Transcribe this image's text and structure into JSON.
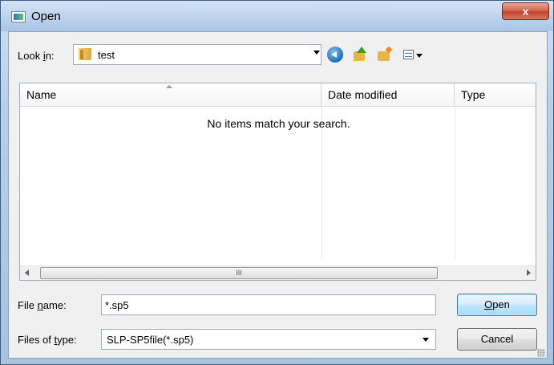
{
  "window": {
    "title": "Open",
    "close_symbol": "x",
    "icon": "app-icon"
  },
  "look_in": {
    "label_prefix": "Look ",
    "label_accel": "i",
    "label_suffix": "n:",
    "value": "test",
    "folder_icon": "folder-icon"
  },
  "toolbar": {
    "icons": [
      "back-icon",
      "up-folder-icon",
      "new-folder-icon",
      "views-icon"
    ]
  },
  "filelist": {
    "columns": [
      "Name",
      "Date modified",
      "Type"
    ],
    "empty_message": "No items match your search.",
    "scroll_thumb_label": "III"
  },
  "file_name": {
    "label_prefix": "File ",
    "label_accel": "n",
    "label_suffix": "ame:",
    "value": "*.sp5"
  },
  "file_type": {
    "label_prefix": "Files of ",
    "label_accel": "t",
    "label_suffix": "ype:",
    "value": "SLP-SP5file(*.sp5)"
  },
  "buttons": {
    "open_accel": "O",
    "open_rest": "pen",
    "cancel": "Cancel"
  },
  "colors": {
    "frame": "#a9c2de",
    "close_button": "#c3442a",
    "default_button": "#bee6fd"
  }
}
